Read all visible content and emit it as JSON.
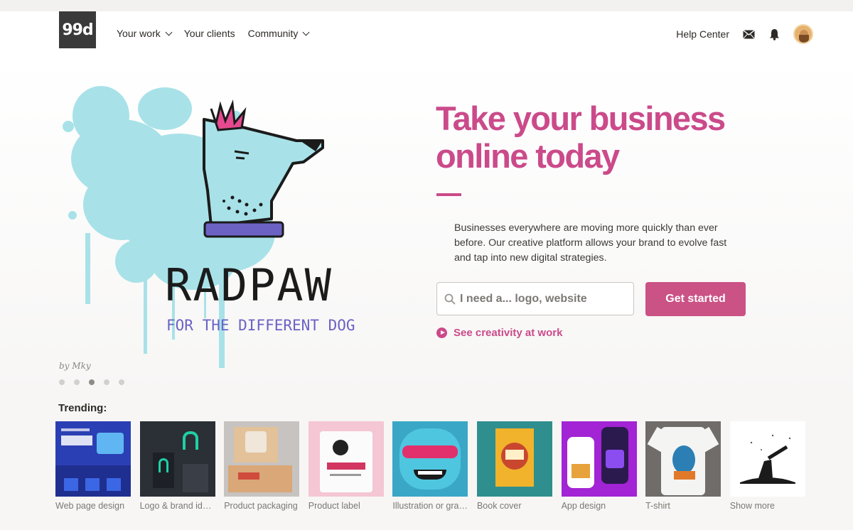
{
  "header": {
    "logo_text": "99d",
    "nav": [
      {
        "label": "Your work",
        "has_dropdown": true
      },
      {
        "label": "Your clients",
        "has_dropdown": false
      },
      {
        "label": "Community",
        "has_dropdown": true
      }
    ],
    "help_label": "Help Center",
    "icons": [
      "mail-icon",
      "bell-icon"
    ]
  },
  "hero": {
    "art_title": "RADPAW",
    "art_tagline": "FOR THE DIFFERENT DOG",
    "byline": "by Mky",
    "slides": 5,
    "active_slide": 3,
    "headline": "Take your business online today",
    "lead": "Businesses everywhere are moving more quickly than ever before. Our creative platform allows your brand to evolve fast and tap into new digital strategies.",
    "search_placeholder": "I need a... logo, website",
    "cta_label": "Get started",
    "link_label": "See creativity at work"
  },
  "trending": {
    "title": "Trending:",
    "items": [
      {
        "label": "Web page design"
      },
      {
        "label": "Logo & brand identity"
      },
      {
        "label": "Product packaging"
      },
      {
        "label": "Product label"
      },
      {
        "label": "Illustration or graphics"
      },
      {
        "label": "Book cover"
      },
      {
        "label": "App design"
      },
      {
        "label": "T-shirt"
      },
      {
        "label": "Show more"
      }
    ]
  },
  "colors": {
    "accent": "#cb4a8a",
    "cta": "#cb5285",
    "paint": "#a8e2e8"
  }
}
